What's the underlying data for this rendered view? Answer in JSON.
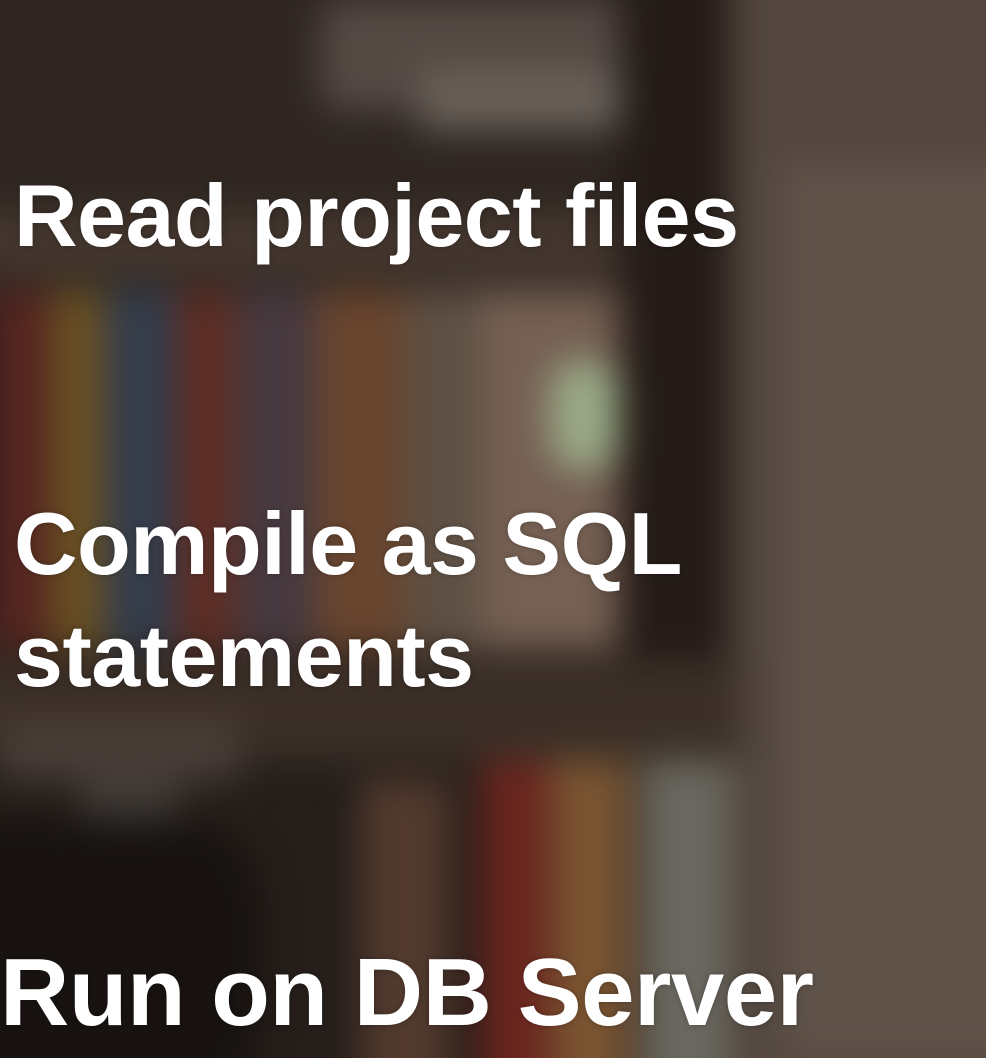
{
  "slide": {
    "lines": [
      "Read project files",
      "Compile as SQL",
      "statements",
      "Run on DB Server"
    ]
  }
}
